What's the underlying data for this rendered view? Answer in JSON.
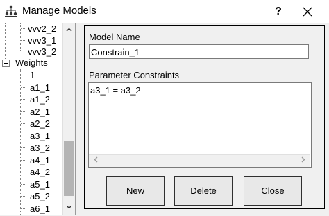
{
  "window": {
    "title": "Manage Models",
    "help_label": "?"
  },
  "tree": {
    "items": [
      {
        "label": "vvv2_2",
        "level": 2
      },
      {
        "label": "vvv3_1",
        "level": 2
      },
      {
        "label": "vvv3_2",
        "level": 2
      },
      {
        "label": "Weights",
        "level": 1,
        "expanded": true
      },
      {
        "label": "1",
        "level": 2
      },
      {
        "label": "a1_1",
        "level": 2
      },
      {
        "label": "a1_2",
        "level": 2
      },
      {
        "label": "a2_1",
        "level": 2
      },
      {
        "label": "a2_2",
        "level": 2
      },
      {
        "label": "a3_1",
        "level": 2
      },
      {
        "label": "a3_2",
        "level": 2
      },
      {
        "label": "a4_1",
        "level": 2
      },
      {
        "label": "a4_2",
        "level": 2
      },
      {
        "label": "a5_1",
        "level": 2
      },
      {
        "label": "a5_2",
        "level": 2
      },
      {
        "label": "a6_1",
        "level": 2
      }
    ]
  },
  "form": {
    "model_name_label": "Model Name",
    "model_name_value": "Constrain_1",
    "constraints_label": "Parameter Constraints",
    "constraints_value": "a3_1 = a3_2"
  },
  "buttons": {
    "new": {
      "mnemonic": "N",
      "rest": "ew"
    },
    "delete": {
      "mnemonic": "D",
      "rest": "elete"
    },
    "close": {
      "mnemonic": "C",
      "rest": "lose"
    }
  },
  "icons": {
    "app": "model-tree-icon",
    "close": "close-icon",
    "scroll_up": "scroll-up-arrow-icon",
    "scroll_down": "scroll-down-arrow-icon",
    "scroll_left": "scroll-left-arrow-icon",
    "scroll_right": "scroll-right-arrow-icon"
  }
}
